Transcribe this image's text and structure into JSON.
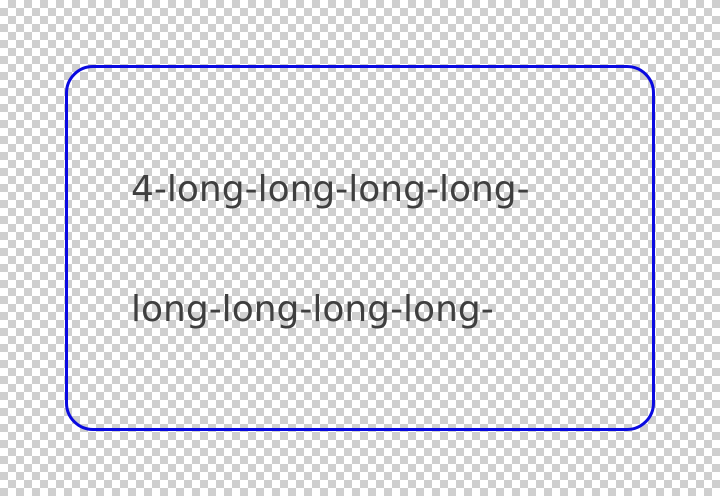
{
  "card": {
    "border_color": "#0a0ae0",
    "lines": [
      "4-long-long-long-long-",
      "long-long-long-long-"
    ]
  },
  "text_color": "#3f3f3f",
  "background": "transparency-checkerboard"
}
